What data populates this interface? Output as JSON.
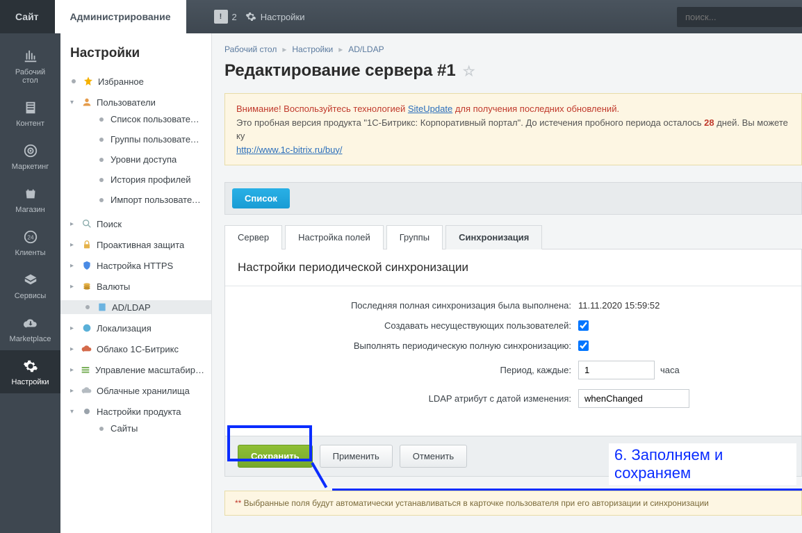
{
  "topbar": {
    "site": "Сайт",
    "admin": "Администрирование",
    "badge_count": "2",
    "settings": "Настройки",
    "search_placeholder": "поиск..."
  },
  "leftrail": [
    {
      "id": "desktop",
      "label": "Рабочий\nстол"
    },
    {
      "id": "content",
      "label": "Контент"
    },
    {
      "id": "marketing",
      "label": "Маркетинг"
    },
    {
      "id": "shop",
      "label": "Магазин"
    },
    {
      "id": "clients",
      "label": "Клиенты"
    },
    {
      "id": "services",
      "label": "Сервисы"
    },
    {
      "id": "marketplace",
      "label": "Marketplace"
    },
    {
      "id": "settings",
      "label": "Настройки",
      "active": true
    }
  ],
  "sidebar": {
    "title": "Настройки",
    "items": {
      "fav": "Избранное",
      "users": "Пользователи",
      "users_list": "Список пользователей",
      "users_groups": "Группы пользователей",
      "users_access": "Уровни доступа",
      "users_history": "История профилей",
      "users_import": "Импорт пользователей",
      "search": "Поиск",
      "proactive": "Проактивная защита",
      "https": "Настройка HTTPS",
      "currency": "Валюты",
      "adldap": "AD/LDAP",
      "locale": "Локализация",
      "cloud1c": "Облако 1С-Битрикс",
      "scaling": "Управление масштабированием",
      "cloudstore": "Облачные хранилища",
      "product": "Настройки продукта",
      "sites": "Сайты"
    }
  },
  "breadcrumb": {
    "a": "Рабочий стол",
    "b": "Настройки",
    "c": "AD/LDAP"
  },
  "page_title": "Редактирование сервера #1",
  "notice": {
    "warn": "Внимание! Воспользуйтесь технологией ",
    "link1": "SiteUpdate",
    "warn2": " для получения последних обновлений.",
    "line2a": "Это пробная версия продукта \"1С-Битрикс: Корпоративный портал\". До истечения пробного периода осталось ",
    "days": "28",
    "line2b": " дней. Вы можете ку",
    "link2": "http://www.1c-bitrix.ru/buy/"
  },
  "toolbar": {
    "list": "Список"
  },
  "tabs": {
    "server": "Сервер",
    "fields": "Настройка полей",
    "groups": "Группы",
    "sync": "Синхронизация"
  },
  "panel": {
    "header": "Настройки периодической синхронизации",
    "row_last": "Последняя полная синхронизация была выполнена:",
    "val_last": "11.11.2020 15:59:52",
    "row_create": "Создавать несуществующих пользователей:",
    "row_periodic": "Выполнять периодическую полную синхронизацию:",
    "row_period": "Период, каждые:",
    "val_period": "1",
    "unit_period": "часа",
    "row_attr": "LDAP атрибут с датой изменения:",
    "val_attr": "whenChanged"
  },
  "actions": {
    "save": "Сохранить",
    "apply": "Применить",
    "cancel": "Отменить"
  },
  "hint": {
    "ast": "**",
    "text": " Выбранные поля будут автоматически устанавливаться в карточке пользователя при его авторизации и синхронизации"
  },
  "annotation": "6. Заполняем и сохраняем"
}
